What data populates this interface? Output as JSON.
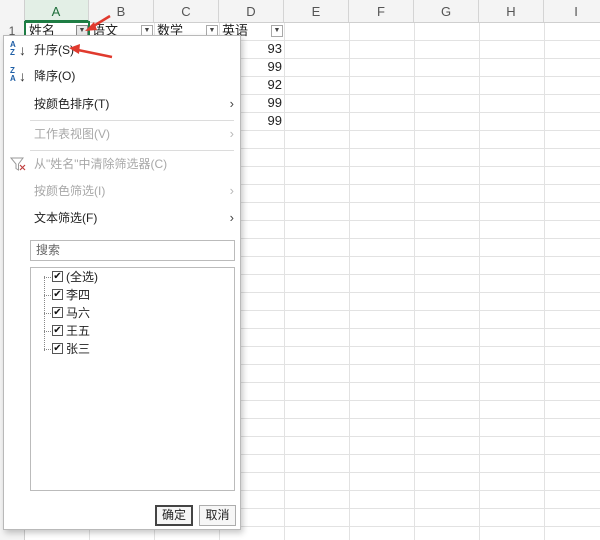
{
  "sheet": {
    "columns": [
      "A",
      "B",
      "C",
      "D",
      "E",
      "F",
      "G",
      "H",
      "I"
    ],
    "rows": [
      "1"
    ],
    "headers": {
      "name": "姓名",
      "chinese": "语文",
      "math": "数学",
      "english": "英语"
    },
    "english_scores": [
      "93",
      "99",
      "92",
      "99",
      "99"
    ]
  },
  "filter_menu": {
    "sort_asc": "升序(S)",
    "sort_desc": "降序(O)",
    "sort_by_color": "按颜色排序(T)",
    "sheet_view": "工作表视图(V)",
    "clear_filter": "从\"姓名\"中清除筛选器(C)",
    "filter_by_color": "按颜色筛选(I)",
    "text_filter": "文本筛选(F)",
    "search_placeholder": "搜索",
    "items": [
      "(全选)",
      "李四",
      "马六",
      "王五",
      "张三"
    ],
    "ok": "确定",
    "cancel": "取消"
  },
  "colors": {
    "accent": "#1e7d44",
    "annotation": "#e03a2e"
  }
}
